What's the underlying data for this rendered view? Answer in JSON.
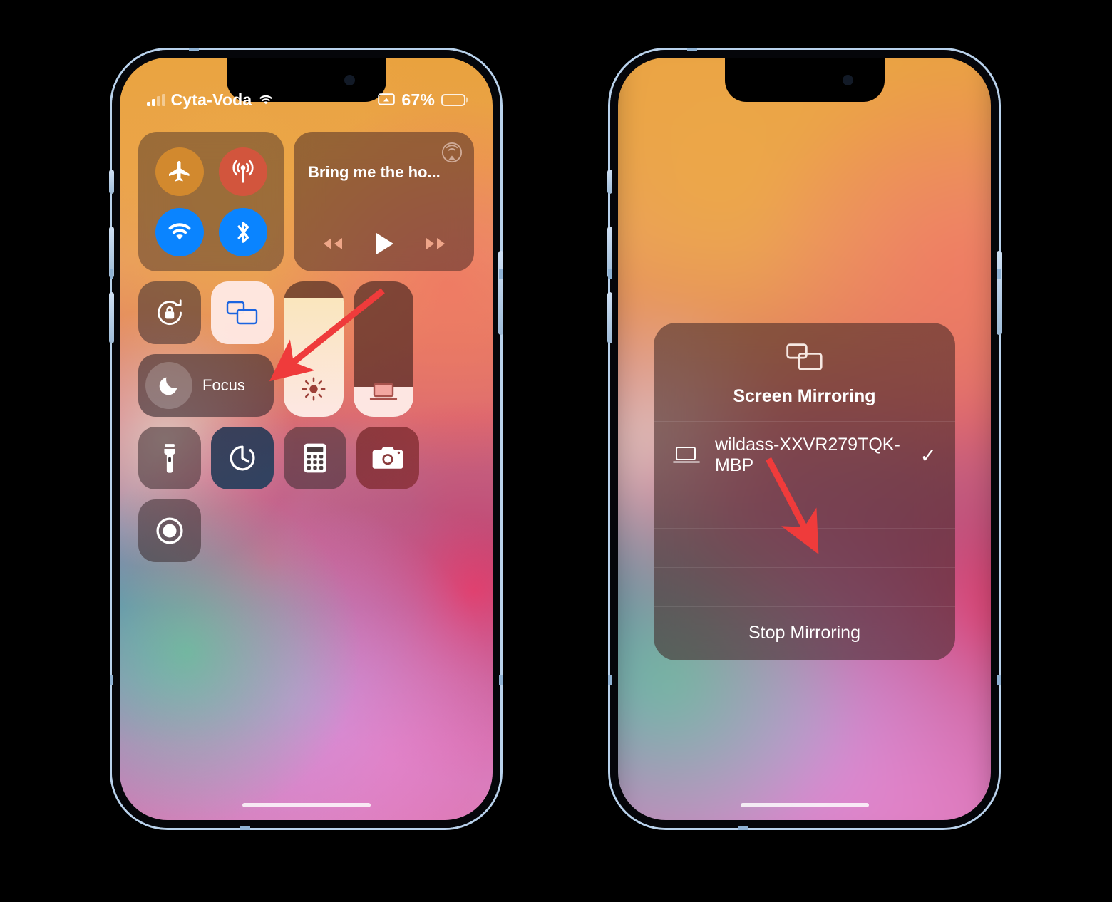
{
  "screens": {
    "left": {
      "label": "control-center-screen",
      "statusbar": {
        "carrier": "Cyta-Voda",
        "battery_percent": "67%",
        "battery_level": 67,
        "icons": [
          "signal-bars-icon",
          "wifi-icon",
          "screen-mirroring-icon",
          "battery-icon"
        ]
      },
      "control_center": {
        "connectivity": [
          {
            "name": "airplane-mode-toggle",
            "icon": "airplane-icon",
            "state": "off"
          },
          {
            "name": "cellular-data-toggle",
            "icon": "cellular-icon",
            "state": "on"
          },
          {
            "name": "wifi-toggle",
            "icon": "wifi-icon",
            "state": "on"
          },
          {
            "name": "bluetooth-toggle",
            "icon": "bluetooth-icon",
            "state": "on"
          }
        ],
        "media": {
          "track_title": "Bring me the ho...",
          "airplay_icon": "airplay-audio-icon",
          "controls": [
            "rewind-icon",
            "play-icon",
            "fast-forward-icon"
          ]
        },
        "rotation_lock": {
          "icon": "rotation-lock-icon",
          "state": "off"
        },
        "screen_mirroring_tile": {
          "icon": "screen-mirroring-icon",
          "state": "active"
        },
        "focus": {
          "label": "Focus",
          "icon": "moon-icon"
        },
        "brightness": {
          "icon": "brightness-sun-icon",
          "level": 88
        },
        "volume": {
          "icon": "laptop-icon",
          "level": 22
        },
        "shortcuts": [
          {
            "name": "flashlight-button",
            "icon": "flashlight-icon"
          },
          {
            "name": "timer-button",
            "icon": "timer-icon"
          },
          {
            "name": "calculator-button",
            "icon": "calculator-icon"
          },
          {
            "name": "camera-button",
            "icon": "camera-icon"
          },
          {
            "name": "screen-record-button",
            "icon": "record-icon"
          }
        ]
      },
      "annotation": {
        "arrow": "red-arrow-to-screen-mirroring"
      }
    },
    "right": {
      "label": "screen-mirroring-panel-screen",
      "panel": {
        "title": "Screen Mirroring",
        "header_icon": "screen-mirroring-icon",
        "devices": [
          {
            "name": "wildass-XXVR279TQK-MBP",
            "icon": "laptop-icon",
            "selected": true,
            "check_glyph": "✓"
          }
        ],
        "stop_label": "Stop Mirroring"
      },
      "annotation": {
        "arrow": "red-arrow-to-stop-mirroring"
      }
    }
  },
  "colors": {
    "accent_blue": "#0a84ff",
    "mirroring_icon_blue": "#1b64e0",
    "arrow_red": "#ef3b3b",
    "frame": "#b9d2ec",
    "background": "#000000"
  }
}
